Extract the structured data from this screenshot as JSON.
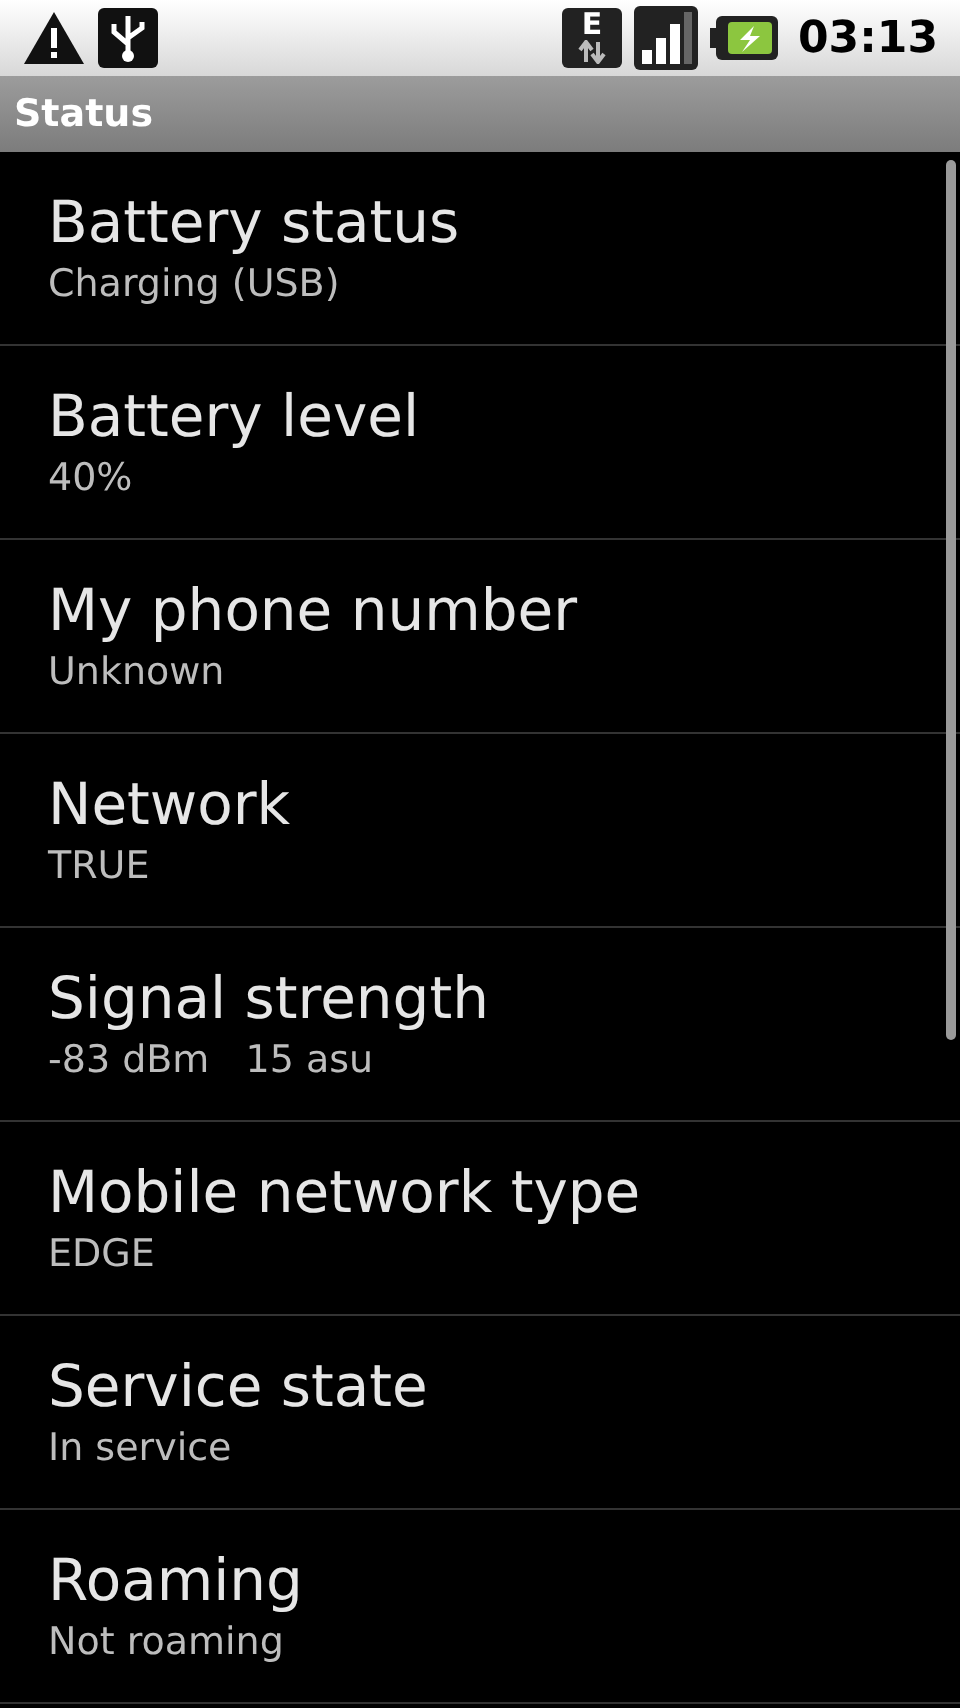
{
  "status_bar": {
    "network_type": "E",
    "time": "03:13"
  },
  "title_bar": {
    "title": "Status"
  },
  "items": [
    {
      "title": "Battery status",
      "summary": "Charging (USB)"
    },
    {
      "title": "Battery level",
      "summary": "40%"
    },
    {
      "title": "My phone number",
      "summary": "Unknown"
    },
    {
      "title": "Network",
      "summary": "TRUE"
    },
    {
      "title": "Signal strength",
      "summary": "-83 dBm   15 asu"
    },
    {
      "title": "Mobile network type",
      "summary": "EDGE"
    },
    {
      "title": "Service state",
      "summary": "In service"
    },
    {
      "title": "Roaming",
      "summary": "Not roaming"
    }
  ]
}
